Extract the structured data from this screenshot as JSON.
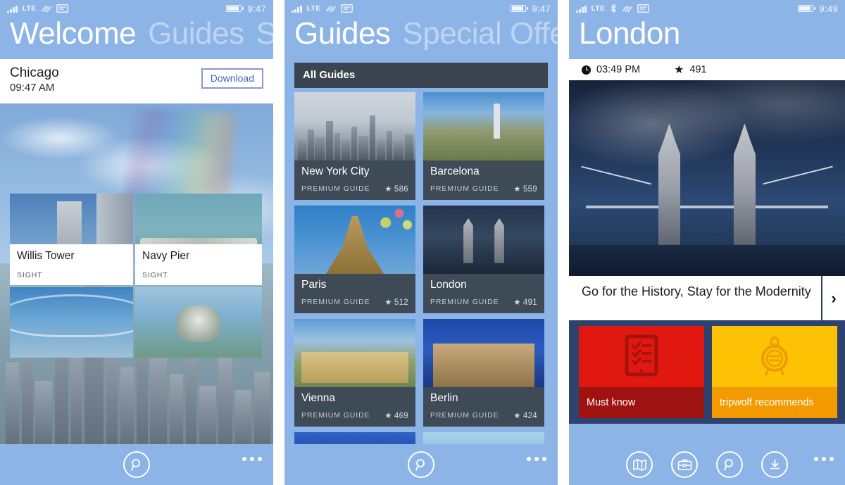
{
  "phones": [
    {
      "id": "welcome",
      "status": {
        "network": "LTE",
        "time": "9:47",
        "icons": [
          "signal-bars-icon",
          "lte-label",
          "wifi-icon",
          "sim-card-icon",
          "battery-icon"
        ]
      },
      "panorama": {
        "title": "Welcome",
        "next": "Guides",
        "next2": "Sp"
      },
      "city": {
        "name": "Chicago",
        "time": "09:47 AM",
        "download_label": "Download"
      },
      "tiles": [
        {
          "title": "Willis Tower",
          "subtitle": "SIGHT"
        },
        {
          "title": "Navy Pier",
          "subtitle": "SIGHT"
        }
      ],
      "appbar": {
        "search_label": "search-icon",
        "more_label": "more-icon"
      }
    },
    {
      "id": "guides",
      "status": {
        "network": "LTE",
        "time": "9:47",
        "icons": [
          "signal-bars-icon",
          "lte-label",
          "wifi-icon",
          "sim-card-icon",
          "battery-icon"
        ]
      },
      "panorama": {
        "title": "Guides",
        "next": "Special Offe"
      },
      "section_header": "All Guides",
      "guides": [
        {
          "title": "New York City",
          "type": "PREMIUM GUIDE",
          "rating": "586",
          "star": "★"
        },
        {
          "title": "Barcelona",
          "type": "PREMIUM GUIDE",
          "rating": "559",
          "star": "★"
        },
        {
          "title": "Paris",
          "type": "PREMIUM GUIDE",
          "rating": "512",
          "star": "★"
        },
        {
          "title": "London",
          "type": "PREMIUM GUIDE",
          "rating": "491",
          "star": "★"
        },
        {
          "title": "Vienna",
          "type": "PREMIUM GUIDE",
          "rating": "469",
          "star": "★"
        },
        {
          "title": "Berlin",
          "type": "PREMIUM GUIDE",
          "rating": "424",
          "star": "★"
        }
      ],
      "appbar": {
        "search_label": "search-icon",
        "more_label": "more-icon"
      }
    },
    {
      "id": "london-detail",
      "status": {
        "network": "LTE",
        "time": "9:49",
        "icons": [
          "signal-bars-icon",
          "lte-label",
          "bluetooth-icon",
          "wifi-icon",
          "sim-card-icon",
          "battery-icon"
        ]
      },
      "panorama": {
        "title": "London"
      },
      "info": {
        "local_time": "03:49 PM",
        "rating": "491",
        "star": "★"
      },
      "caption": "Go for the History, Stay for the Modernity",
      "next_label": "›",
      "tiles": [
        {
          "label": "Must know",
          "icon": "checklist-icon",
          "color": "#e0180f"
        },
        {
          "label": "tripwolf recommends",
          "icon": "seal-badge-icon",
          "color": "#fcc203"
        }
      ],
      "appbar": {
        "items": [
          "map-icon",
          "briefcase-icon",
          "search-icon",
          "download-icon"
        ],
        "more_label": "more-icon"
      }
    }
  ],
  "theme": {
    "accent": "#8cb4e6",
    "tile_dark": "#3f4a57",
    "section_dark": "#3b4551",
    "panel_blue": "#2e4270",
    "red": "#e0180f",
    "yellow": "#fcc203"
  }
}
